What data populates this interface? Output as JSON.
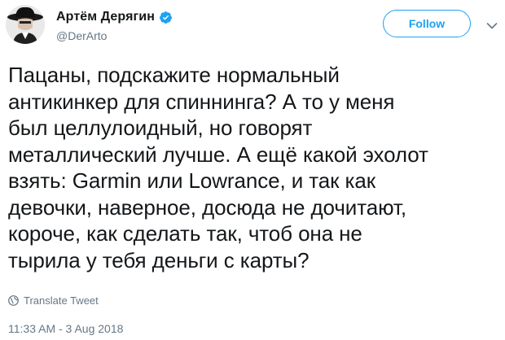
{
  "author": {
    "display_name": "Артём Дерягин",
    "handle": "@DerArto",
    "verified_icon": "verified-badge-icon",
    "avatar_icon": "cowboy-hat-avatar"
  },
  "actions": {
    "follow_label": "Follow",
    "caret_icon": "chevron-down-icon"
  },
  "tweet": {
    "text": "Пацаны, подскажите нормальный\nантикинкер для спиннинга? А то у меня\nбыл целлулоидный, но говорят\nметаллический лучше. А ещё какой эхолот\nвзять: Garmin или Lowrance, и так как\nдевочки, наверное, досюда не дочитают,\nкороче, как сделать так, чтоб она не\nтырила у тебя деньги с карты?",
    "translate_label": "Translate Tweet",
    "translate_icon": "globe-icon",
    "timestamp": "11:33 AM - 3 Aug 2018"
  },
  "colors": {
    "accent": "#1da1f2",
    "text": "#14171a",
    "muted": "#657786",
    "background": "#ffffff"
  }
}
